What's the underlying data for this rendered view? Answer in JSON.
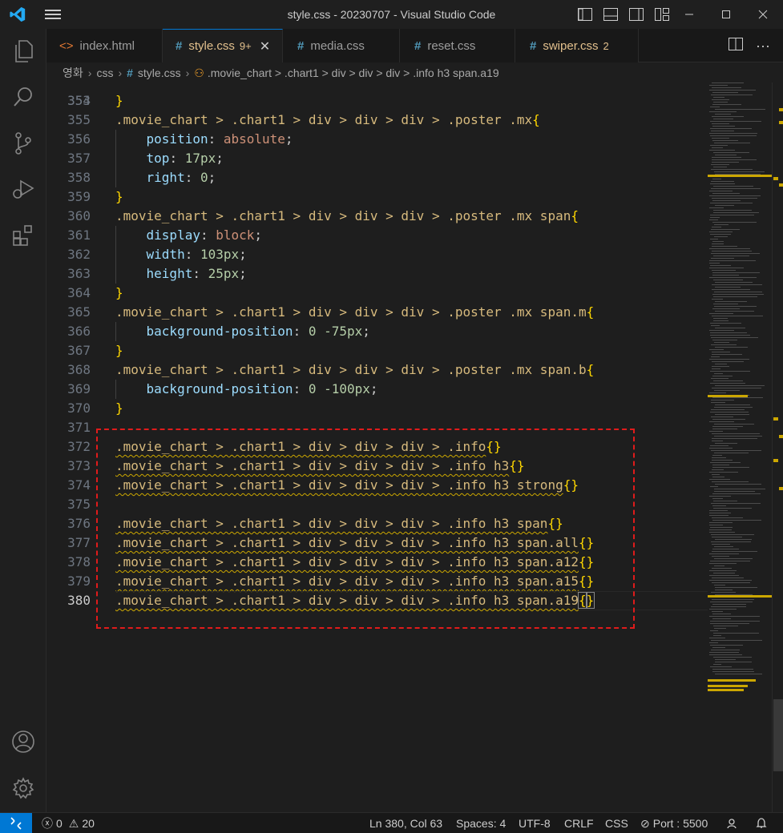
{
  "window": {
    "title": "style.css - 20230707 - Visual Studio Code"
  },
  "tabs": [
    {
      "label": "index.html",
      "icon": "html-icon",
      "badge": ""
    },
    {
      "label": "style.css",
      "icon": "css-hash-icon",
      "badge": "9+",
      "active": true
    },
    {
      "label": "media.css",
      "icon": "css-hash-icon",
      "badge": ""
    },
    {
      "label": "reset.css",
      "icon": "css-hash-icon",
      "badge": ""
    },
    {
      "label": "swiper.css",
      "icon": "css-hash-icon",
      "badge": "2"
    }
  ],
  "breadcrumb": {
    "folder1": "영화",
    "folder2": "css",
    "file": "style.css",
    "symbol": ".movie_chart > .chart1 > div > div > div > .info h3 span.a19"
  },
  "editor": {
    "first_line_partial": "353",
    "lines": [
      {
        "n": "354",
        "t": "}"
      },
      {
        "n": "355",
        "t": ".movie_chart > .chart1 > div > div > div > .poster .mx{"
      },
      {
        "n": "356",
        "t": "    position: absolute;"
      },
      {
        "n": "357",
        "t": "    top: 17px;"
      },
      {
        "n": "358",
        "t": "    right: 0;"
      },
      {
        "n": "359",
        "t": "}"
      },
      {
        "n": "360",
        "t": ".movie_chart > .chart1 > div > div > div > .poster .mx span{"
      },
      {
        "n": "361",
        "t": "    display: block;"
      },
      {
        "n": "362",
        "t": "    width: 103px;"
      },
      {
        "n": "363",
        "t": "    height: 25px;"
      },
      {
        "n": "364",
        "t": "}"
      },
      {
        "n": "365",
        "t": ".movie_chart > .chart1 > div > div > div > .poster .mx span.m{"
      },
      {
        "n": "366",
        "t": "    background-position: 0 -75px;"
      },
      {
        "n": "367",
        "t": "}"
      },
      {
        "n": "368",
        "t": ".movie_chart > .chart1 > div > div > div > .poster .mx span.b{"
      },
      {
        "n": "369",
        "t": "    background-position: 0 -100px;"
      },
      {
        "n": "370",
        "t": "}"
      },
      {
        "n": "371",
        "t": ""
      },
      {
        "n": "372",
        "t": ".movie_chart > .chart1 > div > div > div > .info{}"
      },
      {
        "n": "373",
        "t": ".movie_chart > .chart1 > div > div > div > .info h3{}"
      },
      {
        "n": "374",
        "t": ".movie_chart > .chart1 > div > div > div > .info h3 strong{}"
      },
      {
        "n": "375",
        "t": ""
      },
      {
        "n": "376",
        "t": ".movie_chart > .chart1 > div > div > div > .info h3 span{}"
      },
      {
        "n": "377",
        "t": ".movie_chart > .chart1 > div > div > div > .info h3 span.all{}"
      },
      {
        "n": "378",
        "t": ".movie_chart > .chart1 > div > div > div > .info h3 span.a12{}"
      },
      {
        "n": "379",
        "t": ".movie_chart > .chart1 > div > div > div > .info h3 span.a15{}"
      },
      {
        "n": "380",
        "t": ".movie_chart > .chart1 > div > div > div > .info h3 span.a19{}"
      }
    ],
    "current_line": "380"
  },
  "status": {
    "errors": "0",
    "warnings": "20",
    "position": "Ln 380, Col 63",
    "spaces": "Spaces: 4",
    "encoding": "UTF-8",
    "eol": "CRLF",
    "language": "CSS",
    "port": "Port : 5500"
  },
  "colors": {
    "accent": "#0078d4",
    "selector": "#d7ba7d",
    "property": "#9cdcfe",
    "value": "#ce9178",
    "number": "#b5cea8",
    "brace": "#ffd700",
    "warning": "#cca700",
    "annotation": "#e01b1b"
  }
}
